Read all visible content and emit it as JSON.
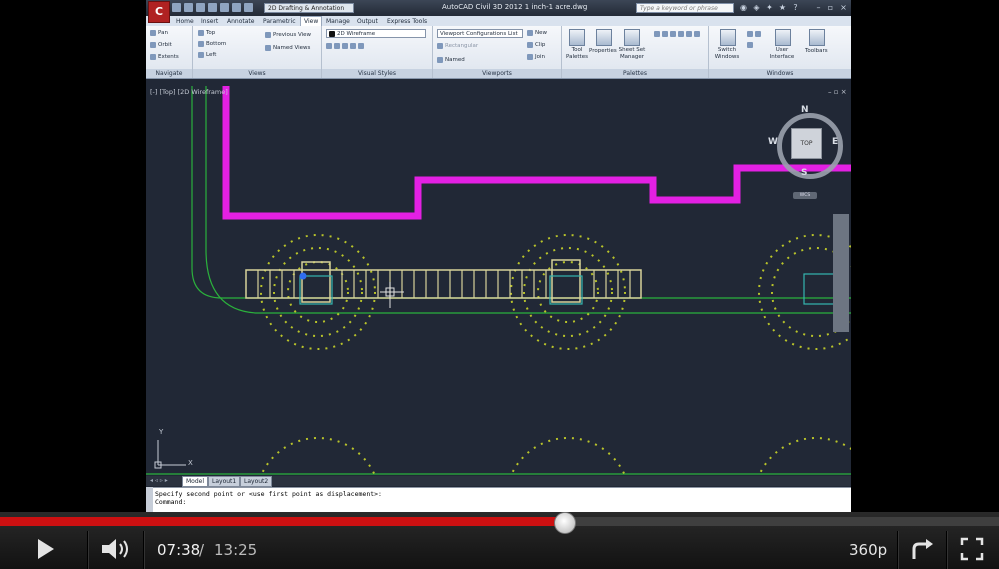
{
  "app": {
    "title": "AutoCAD Civil 3D 2012    1 inch-1 acre.dwg",
    "app_button": "C",
    "workspace": "2D Drafting & Annotation",
    "search_placeholder": "Type a keyword or phrase"
  },
  "tabs": [
    {
      "label": "Home"
    },
    {
      "label": "Insert"
    },
    {
      "label": "Annotate"
    },
    {
      "label": "Parametric"
    },
    {
      "label": "View",
      "active": true
    },
    {
      "label": "Manage"
    },
    {
      "label": "Output"
    },
    {
      "label": "Express Tools"
    }
  ],
  "ribbon": {
    "navigate": {
      "title": "Navigate",
      "items": [
        "Pan",
        "Orbit",
        "Extents"
      ]
    },
    "views": {
      "title": "Views",
      "items": [
        "Top",
        "Bottom",
        "Left"
      ],
      "previous": "Previous View",
      "named": "Named Views"
    },
    "visual_styles": {
      "title": "Visual Styles",
      "current": "2D Wireframe"
    },
    "viewports": {
      "title": "Viewports",
      "config": "Viewport Configurations List",
      "rect": "Rectangular",
      "named": "Named",
      "new": "New",
      "clip": "Clip",
      "join": "Join"
    },
    "palettes": {
      "title": "Palettes",
      "tool": "Tool Palettes",
      "properties": "Properties",
      "sheetset": "Sheet Set Manager"
    },
    "windows": {
      "title": "Windows",
      "switch": "Switch Windows",
      "ui": "User Interface",
      "toolbars": "Toolbars"
    }
  },
  "viewport": {
    "label": "[-] [Top] [2D Wireframe]",
    "controls": "– ▫ ×",
    "compass": {
      "n": "N",
      "s": "S",
      "e": "E",
      "w": "W",
      "top": "TOP",
      "wcs": "WCS"
    },
    "ucs_y": "Y",
    "ucs_x": "X"
  },
  "layout_tabs": [
    "Model",
    "Layout1",
    "Layout2"
  ],
  "command": {
    "line1": "Specify second point or <use first point as displacement>:",
    "line2": "Command:"
  },
  "player": {
    "current_time": "07:38",
    "separator": "/",
    "duration": "13:25",
    "progress": 0.565,
    "quality": "360p",
    "colors": {
      "played": "#cc1011",
      "track": "#3f3f3f"
    }
  }
}
